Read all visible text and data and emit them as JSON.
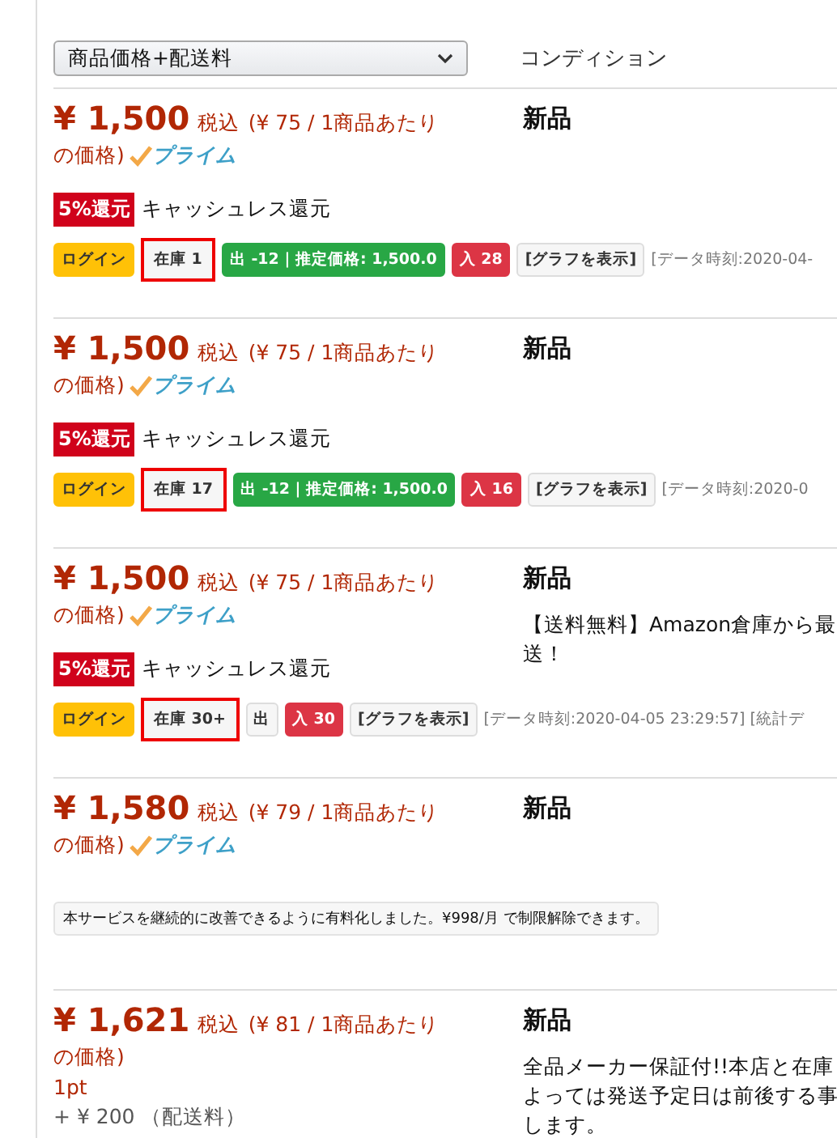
{
  "header": {
    "sort_select": "商品価格+配送料",
    "condition_heading": "コンディション"
  },
  "offers": [
    {
      "price": "¥ 1,500",
      "tax": "税込",
      "unit_price": [
        "(¥ 75 / 1商品あたり",
        "の価格)"
      ],
      "prime": true,
      "prime_label": "プライム",
      "cashless": {
        "badge": "5%還元",
        "label": "キャッシュレス還元"
      },
      "tags": [
        {
          "kind": "login",
          "text": "ログイン"
        },
        {
          "kind": "stock",
          "text": "在庫 1",
          "highlighted": true
        },
        {
          "kind": "sold",
          "text": "出 -12 | 推定価格: 1,500.0"
        },
        {
          "kind": "bought",
          "text": "入 28"
        },
        {
          "kind": "graph",
          "text": "[グラフを表示]"
        },
        {
          "kind": "meta",
          "text": "[データ時刻:2020-04-"
        }
      ],
      "condition": "新品"
    },
    {
      "price": "¥ 1,500",
      "tax": "税込",
      "unit_price": [
        "(¥ 75 / 1商品あたり",
        "の価格)"
      ],
      "prime": true,
      "prime_label": "プライム",
      "cashless": {
        "badge": "5%還元",
        "label": "キャッシュレス還元"
      },
      "tags": [
        {
          "kind": "login",
          "text": "ログイン"
        },
        {
          "kind": "stock",
          "text": "在庫 17",
          "highlighted": true
        },
        {
          "kind": "sold",
          "text": "出 -12 | 推定価格: 1,500.0"
        },
        {
          "kind": "bought",
          "text": "入 16"
        },
        {
          "kind": "graph",
          "text": "[グラフを表示]"
        },
        {
          "kind": "meta",
          "text": "[データ時刻:2020-0"
        }
      ],
      "condition": "新品"
    },
    {
      "price": "¥ 1,500",
      "tax": "税込",
      "unit_price": [
        "(¥ 75 / 1商品あたり",
        "の価格)"
      ],
      "prime": true,
      "prime_label": "プライム",
      "cashless": {
        "badge": "5%還元",
        "label": "キャッシュレス還元"
      },
      "tags": [
        {
          "kind": "login",
          "text": "ログイン"
        },
        {
          "kind": "stock",
          "text": "在庫 30+",
          "highlighted": true
        },
        {
          "kind": "plain",
          "text": "出"
        },
        {
          "kind": "bought",
          "text": "入 30"
        },
        {
          "kind": "graph",
          "text": "[グラフを表示]"
        },
        {
          "kind": "meta",
          "text": "[データ時刻:2020-04-05 23:29:57] [統計デ"
        }
      ],
      "condition": "新品",
      "description": [
        "【送料無料】Amazon倉庫から最",
        "送！"
      ]
    },
    {
      "price": "¥ 1,580",
      "tax": "税込",
      "unit_price": [
        "(¥ 79 / 1商品あたり",
        "の価格)"
      ],
      "prime": true,
      "prime_label": "プライム",
      "notice": "本サービスを継続的に改善できるように有料化しました。¥998/月 で制限解除できます。",
      "condition": "新品"
    },
    {
      "price": "¥ 1,621",
      "tax": "税込",
      "unit_price": [
        "(¥ 81 / 1商品あたり",
        "の価格)"
      ],
      "prime": false,
      "points": "1pt",
      "shipping": "+ ¥ 200 （配送料）",
      "condition": "新品",
      "description": [
        "全品メーカー保証付!!本店と在庫",
        "よっては発送予定日は前後する事",
        "します。"
      ]
    }
  ]
}
